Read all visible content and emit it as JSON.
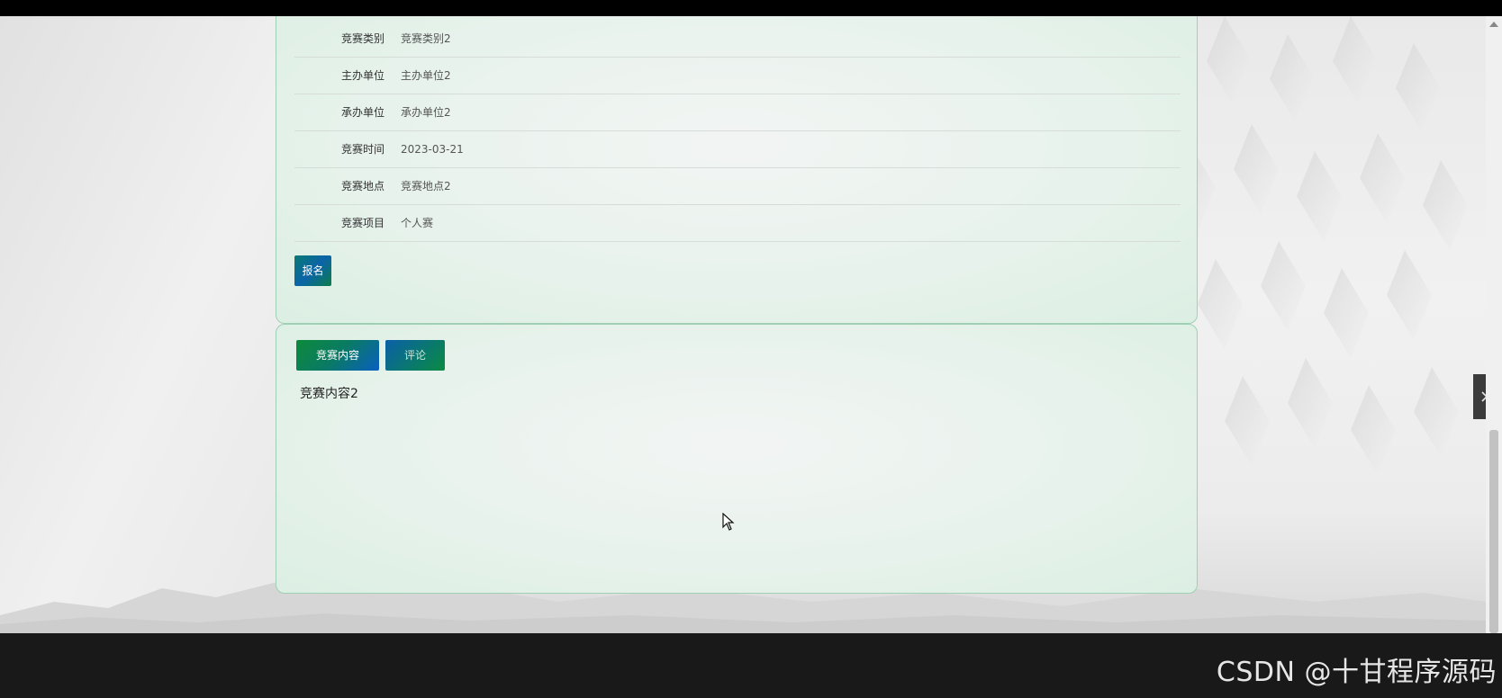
{
  "competition_info": {
    "rows": [
      {
        "label": "竞赛类别",
        "value": "竞赛类别2"
      },
      {
        "label": "主办单位",
        "value": "主办单位2"
      },
      {
        "label": "承办单位",
        "value": "承办单位2"
      },
      {
        "label": "竞赛时间",
        "value": "2023-03-21"
      },
      {
        "label": "竞赛地点",
        "value": "竞赛地点2"
      },
      {
        "label": "竞赛项目",
        "value": "个人赛"
      }
    ],
    "signup_label": "报名"
  },
  "tabs": {
    "content_label": "竞赛内容",
    "comment_label": "评论",
    "active": "content"
  },
  "content": {
    "text": "竞赛内容2"
  },
  "watermark": "CSDN @十甘程序源码",
  "icons": {
    "side_toggle": "chevron-right-icon",
    "cursor": "mouse-pointer-icon"
  },
  "colors": {
    "accent_green": "#0d8a3a",
    "accent_blue": "#0a5fc0",
    "panel_border": "#9fd0b4"
  }
}
